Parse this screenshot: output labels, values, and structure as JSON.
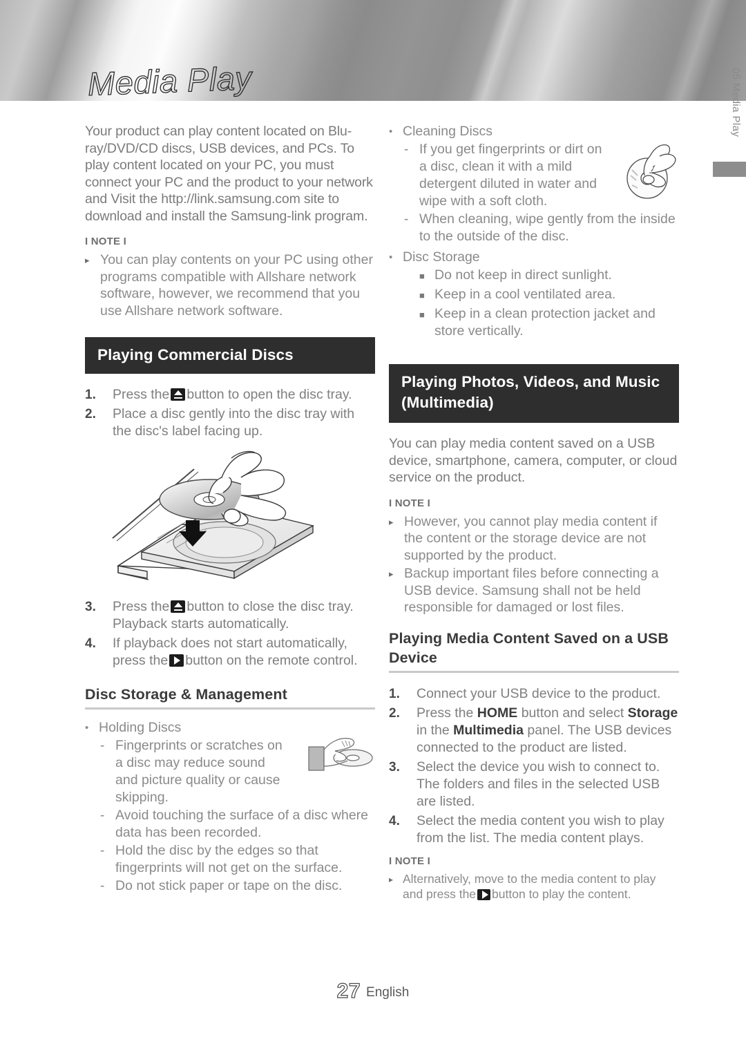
{
  "header": {
    "title": "Media Play"
  },
  "side_tab": {
    "chapter_number": "05",
    "chapter_name": "Media Play",
    "label": "05  Media Play"
  },
  "footer": {
    "page_number": "27",
    "language": "English"
  },
  "left_column": {
    "intro_paragraph": "Your product can play content located on Blu-ray/DVD/CD discs, USB devices, and PCs. To play content located on your PC, you must connect your PC and the product to your network and Visit the http://link.samsung.com site to download and install the Samsung-link program.",
    "note_label": "I NOTE I",
    "note_items": [
      "You can play contents on your PC using other programs compatible with Allshare network software, however, we recommend that you use Allshare network software."
    ],
    "section_header": "Playing Commercial Discs",
    "steps": [
      {
        "num": "1.",
        "before": "Press the",
        "icon": "eject-icon",
        "after": "button to open the disc tray."
      },
      {
        "num": "2.",
        "before": "Place a disc gently into the disc tray with the disc's label facing up.",
        "icon": "",
        "after": ""
      },
      {
        "num": "3.",
        "before": "Press the",
        "icon": "eject-icon",
        "after": "button to close the disc tray. Playback starts automatically."
      },
      {
        "num": "4.",
        "before": "If playback does not start automatically, press the",
        "icon": "play-icon",
        "after": "button on the remote control."
      }
    ],
    "illustration_name": "disc-tray-loading-illustration",
    "storage_header": "Disc Storage & Management",
    "holding_discs_label": "Holding Discs",
    "holding_discs_items": [
      "Fingerprints or scratches on a disc may reduce sound and picture quality or cause skipping.",
      "Avoid touching the surface of a disc where data has been recorded.",
      "Hold the disc by the edges so that fingerprints will not get on the surface.",
      "Do not stick paper or tape on the disc."
    ],
    "holding_illustration_name": "hand-holding-disc-illustration"
  },
  "right_column": {
    "cleaning_discs_label": "Cleaning Discs",
    "cleaning_discs_items": [
      "If you get fingerprints or dirt on a disc, clean it with a mild detergent diluted in water and wipe with a soft cloth.",
      "When cleaning, wipe gently from the inside to the outside of the disc."
    ],
    "cleaning_illustration_name": "cleaning-disc-illustration",
    "disc_storage_label": "Disc Storage",
    "disc_storage_items": [
      "Do not keep in direct sunlight.",
      "Keep in a cool ventilated area.",
      "Keep in a clean protection jacket and store vertically."
    ],
    "section_header_line1": "Playing Photos, Videos, and Music",
    "section_header_line2": "(Multimedia)",
    "intro_paragraph": "You can play media content saved on a USB device, smartphone, camera, computer, or cloud service on the product.",
    "note_label": "I NOTE I",
    "note_items": [
      "However, you cannot play media content if the content or the storage device are not supported by the product.",
      "Backup important files before connecting a USB device. Samsung shall not be held responsible for damaged or lost files."
    ],
    "usb_header_line1": "Playing Media Content Saved on a USB",
    "usb_header_line2": "Device",
    "usb_steps": [
      {
        "num": "1.",
        "text": "Connect your USB device to the product."
      },
      {
        "num": "2.",
        "text": "Press the HOME button and select Storage in the Multimedia panel. The USB devices connected to the product are listed.",
        "bold_terms": [
          "HOME",
          "Storage",
          "Multimedia"
        ]
      },
      {
        "num": "3.",
        "text": "Select the device you wish to connect to. The folders and files in the selected USB are listed."
      },
      {
        "num": "4.",
        "text": "Select the media content you wish to play from the list. The media content plays."
      }
    ],
    "bottom_note_label": "I NOTE I",
    "bottom_note_before": "Alternatively, move to the media content to play and press the",
    "bottom_note_icon": "play-icon",
    "bottom_note_after": "button to play the content."
  },
  "colors": {
    "banner_light": "#fdfdfd",
    "banner_dark": "#8a8a8a",
    "header_bar": "#2e2e2e",
    "body_text": "#7b7b7b",
    "rule": "#c9c9c9"
  }
}
